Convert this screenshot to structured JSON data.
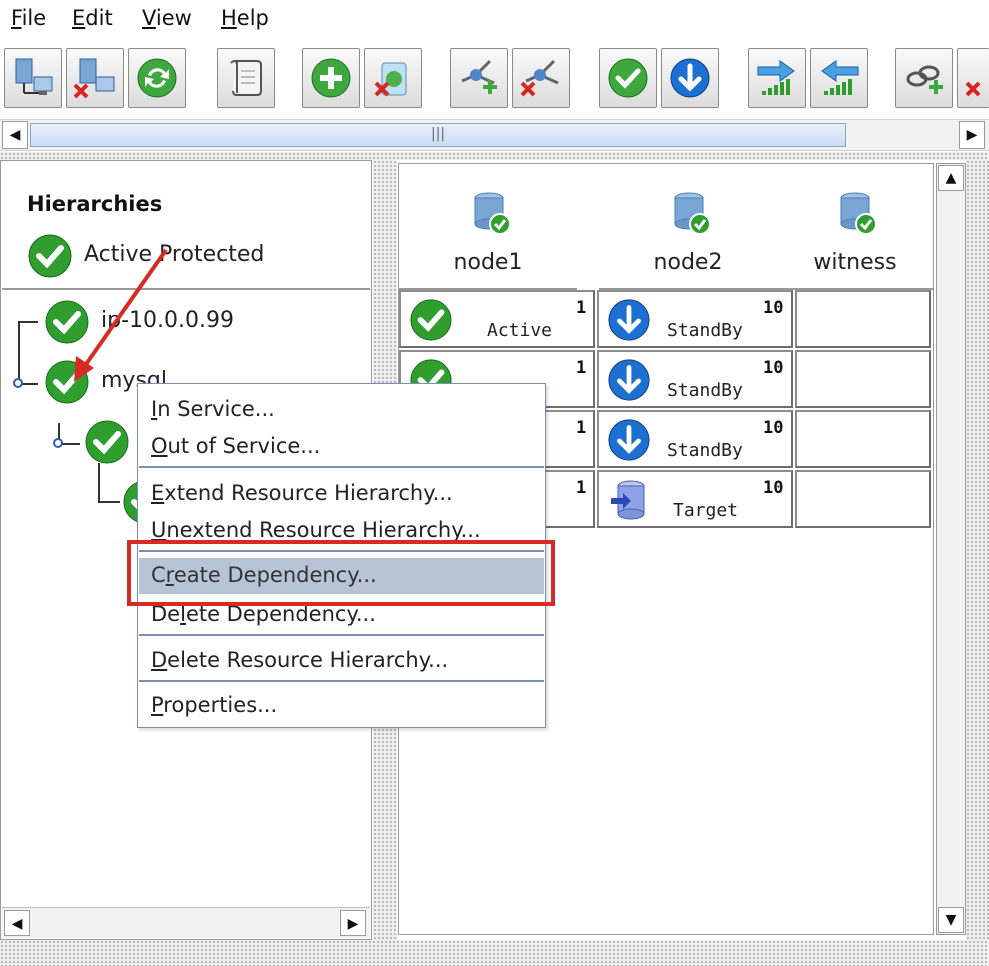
{
  "menubar": {
    "items": [
      {
        "pre": "",
        "key": "F",
        "post": "ile"
      },
      {
        "pre": "",
        "key": "E",
        "post": "dit"
      },
      {
        "pre": "",
        "key": "V",
        "post": "iew"
      },
      {
        "pre": "",
        "key": "H",
        "post": "elp"
      }
    ]
  },
  "toolbar": {
    "buttons": [
      "connect-server-icon",
      "disconnect-server-icon",
      "refresh-icon",
      "log-scroll-icon",
      "create-resource-icon",
      "delete-resource-icon",
      "extend-hierarchy-icon",
      "unextend-hierarchy-icon",
      "in-service-icon",
      "out-of-service-icon",
      "promote-priority-icon",
      "demote-priority-icon",
      "create-dependency-icon",
      "delete-dependency-icon"
    ]
  },
  "left_pane": {
    "title": "Hierarchies",
    "status_label": "Active Protected",
    "tree": [
      {
        "label": "ip-10.0.0.99"
      },
      {
        "label": "mysql"
      }
    ]
  },
  "nodes": [
    "node1",
    "node2",
    "witness"
  ],
  "rows": [
    {
      "node1": {
        "state": "Active",
        "priority": "1"
      },
      "node2": {
        "state": "StandBy",
        "priority": "10"
      }
    },
    {
      "node1": {
        "state": "",
        "priority": "1"
      },
      "node2": {
        "state": "StandBy",
        "priority": "10"
      }
    },
    {
      "node1": {
        "state": "",
        "priority": "1"
      },
      "node2": {
        "state": "StandBy",
        "priority": "10"
      }
    },
    {
      "node1": {
        "state": "",
        "priority": "1"
      },
      "node2": {
        "state": "Target",
        "priority": "10"
      }
    }
  ],
  "context_menu": {
    "items": [
      {
        "key": "I",
        "rest": "n Service..."
      },
      {
        "key": "O",
        "rest": "ut of Service..."
      },
      {
        "key": "E",
        "rest": "xtend Resource Hierarchy..."
      },
      {
        "key": "U",
        "rest": "nextend Resource Hierarchy..."
      },
      {
        "pre": "C",
        "key": "r",
        "rest": "eate Dependency..."
      },
      {
        "pre": "De",
        "key": "l",
        "rest": "ete Dependency..."
      },
      {
        "key": "D",
        "rest": "elete Resource Hierarchy..."
      },
      {
        "key": "P",
        "rest": "roperties..."
      }
    ],
    "highlighted": "Create Dependency..."
  },
  "scroll_grip": "|||",
  "colors": {
    "accent_red": "#d72a23",
    "check_green": "#2f9e2f",
    "standby_blue": "#1d6fd1",
    "menu_border": "#7a8db5"
  }
}
